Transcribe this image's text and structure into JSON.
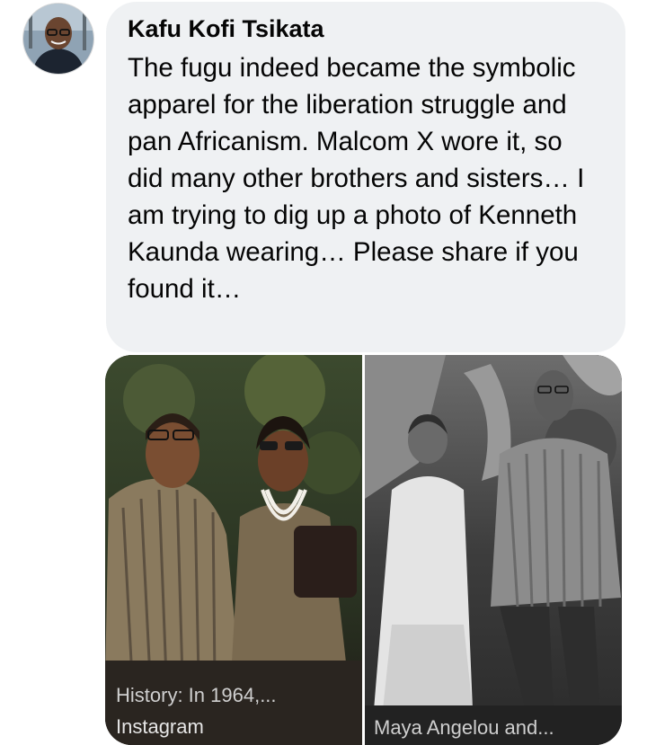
{
  "comment": {
    "author": "Kafu Kofi Tsikata",
    "text": "The fugu indeed became the symbolic apparel for the liberation struggle and pan Africanism. Malcom X wore it, so did many other brothers and sisters… I am trying to dig up a photo of Kenneth Kaunda wearing… Please share if you found it…"
  },
  "attachments": [
    {
      "title": "History: In 1964,...",
      "source": "Instagram",
      "tone": "sepia-color"
    },
    {
      "title": "Maya Angelou and...",
      "tone": "black-and-white"
    }
  ],
  "colors": {
    "bubble_bg": "#eff1f3",
    "text": "#050505",
    "caption": "#d9d9d9"
  }
}
